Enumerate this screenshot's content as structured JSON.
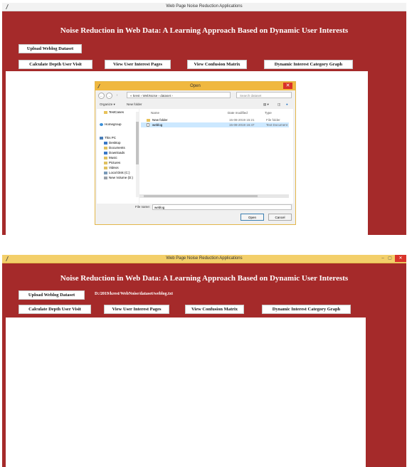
{
  "window_title": "Web Page Noise Reduction Applications",
  "heading": "Noise Reduction in Web Data: A Learning Approach Based on Dynamic User Interests",
  "buttons": {
    "upload": "Upload Weblog Dataset",
    "depth": "Calculate Depth User Visit",
    "interest": "View User Interest Pages",
    "confusion": "View Confusion Matrix",
    "graph": "Dynamic Interest Category Graph"
  },
  "selected_path": "D:/2019/krest/WebNoise/dataset/weblog.txt",
  "controls": {
    "minimize": "–",
    "maximize": "▢",
    "close": "✕"
  },
  "dialog": {
    "title": "Open",
    "close": "✕",
    "address": [
      "« krest",
      "WebNoise",
      "dataset"
    ],
    "search_placeholder": "Search dataset",
    "organize": "Organize ▾",
    "new_folder": "New folder",
    "sidebar": [
      "TestCases",
      "Homegroup",
      "This PC",
      "Desktop",
      "Documents",
      "Downloads",
      "Music",
      "Pictures",
      "Videos",
      "Local Disk (C:)",
      "New Volume (D:)"
    ],
    "columns": {
      "name": "Name",
      "date": "Date modified",
      "type": "Type"
    },
    "files": [
      {
        "name": "New folder",
        "date": "15-08-2019 15:21",
        "type": "File folder"
      },
      {
        "name": "weblog",
        "date": "15-08-2019 16:47",
        "type": "Text Document"
      }
    ],
    "file_name_label": "File name:",
    "file_name_value": "weblog",
    "open": "Open",
    "cancel": "Cancel"
  }
}
